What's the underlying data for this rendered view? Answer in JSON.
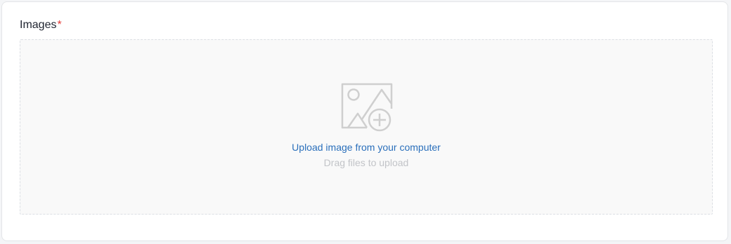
{
  "field": {
    "label": "Images",
    "required_mark": "*"
  },
  "dropzone": {
    "icon": "image-add-icon",
    "upload_link": "Upload image from your computer",
    "hint": "Drag files to upload"
  },
  "colors": {
    "link": "#2a6fbb",
    "required": "#e53935",
    "icon": "#cfcfcf",
    "dropzone_bg": "#f9f9f9",
    "hint": "#c2c4c8"
  }
}
